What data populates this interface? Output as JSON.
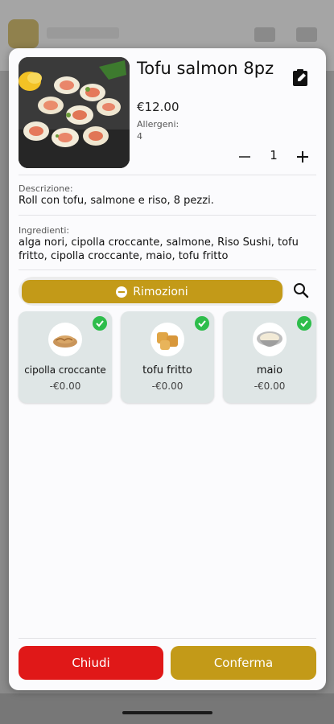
{
  "colors": {
    "accent": "#c39a18",
    "danger": "#e01818",
    "check": "#2dbd4b"
  },
  "product": {
    "name": "Tofu salmon 8pz",
    "price": "€12.00",
    "allergen_label": "Allergeni:",
    "allergen_value": "4",
    "quantity": "1",
    "image_icon": "sushi-roll-photo"
  },
  "description": {
    "label": "Descrizione:",
    "text": "Roll con tofu, salmone e riso, 8 pezzi."
  },
  "ingredients": {
    "label": "Ingredienti:",
    "text": "alga nori, cipolla croccante, salmone, Riso Sushi, tofu fritto, cipolla croccante, maio, tofu fritto"
  },
  "removals": {
    "label": "Rimozioni",
    "items": [
      {
        "name": "cipolla croccante",
        "price": "-€0.00",
        "checked": true
      },
      {
        "name": "tofu fritto",
        "price": "-€0.00",
        "checked": true
      },
      {
        "name": "maio",
        "price": "-€0.00",
        "checked": true
      }
    ]
  },
  "footer": {
    "close_label": "Chiudi",
    "confirm_label": "Conferma"
  }
}
